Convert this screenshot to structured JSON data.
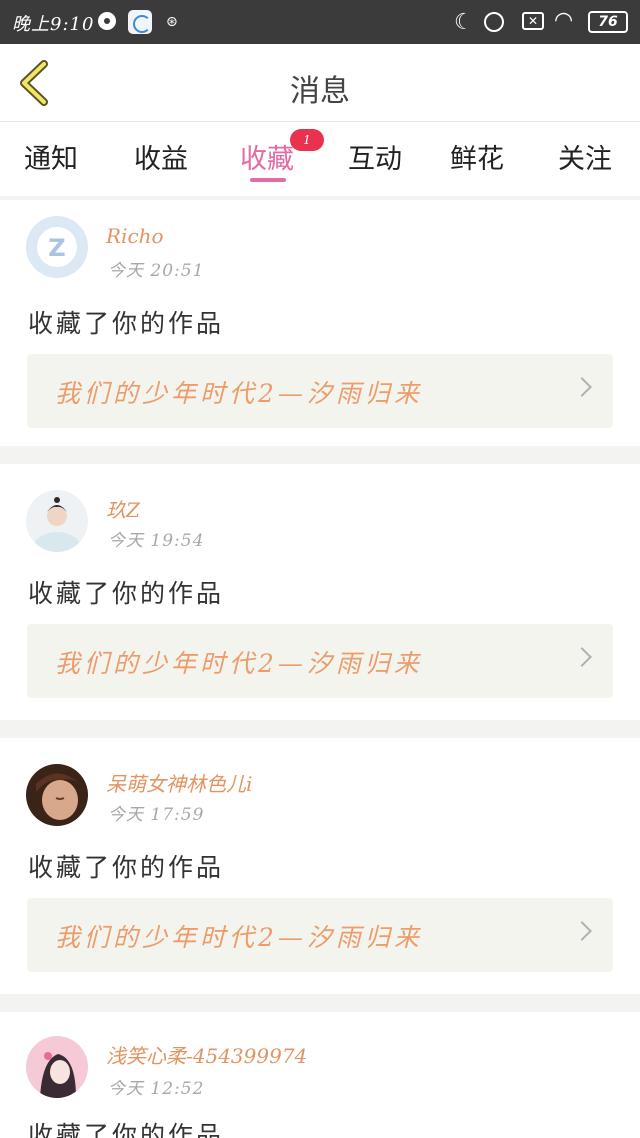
{
  "status_bar": {
    "time": "晚上9:10",
    "small_icon": "⊛",
    "moon": "☾",
    "wifi": "◠",
    "x_label": "✕",
    "battery": "76"
  },
  "header": {
    "title": "消息",
    "back_icon": "chevron-left-icon"
  },
  "tabs": [
    {
      "label": "通知"
    },
    {
      "label": "收益"
    },
    {
      "label": "收藏",
      "active": true,
      "badge": "1"
    },
    {
      "label": "互动"
    },
    {
      "label": "鲜花"
    },
    {
      "label": "关注"
    }
  ],
  "colors": {
    "accent": "#e46aa4",
    "username": "#e29462",
    "work_title": "#ec9d6b",
    "badge": "#e9324e"
  },
  "messages": [
    {
      "username": "Richo",
      "time": "今天 20:51",
      "action": "收藏了你的作品",
      "work_title": "我们的少年时代2—汐雨归来"
    },
    {
      "username": "玖Z",
      "time": "今天 19:54",
      "action": "收藏了你的作品",
      "work_title": "我们的少年时代2—汐雨归来"
    },
    {
      "username": "呆萌女神林色儿i",
      "time": "今天 17:59",
      "action": "收藏了你的作品",
      "work_title": "我们的少年时代2—汐雨归来"
    },
    {
      "username": "浅笑心柔-454399974",
      "time": "今天 12:52",
      "action": "收藏了你的作品",
      "work_title": ""
    }
  ]
}
